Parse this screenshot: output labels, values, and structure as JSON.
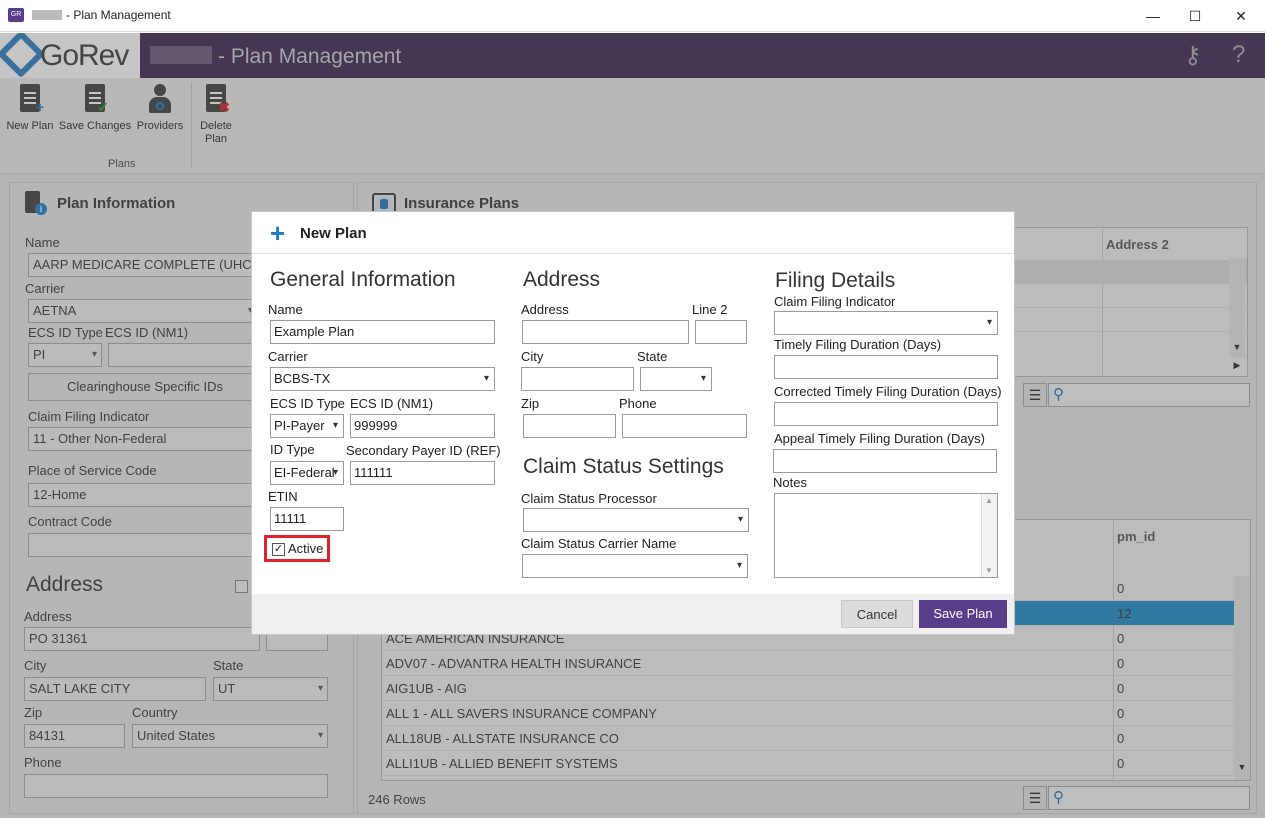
{
  "window": {
    "title": "- Plan Management",
    "minimize": "—",
    "maximize": "☐",
    "close": "✕"
  },
  "header": {
    "logo": "GoRev",
    "title": "- Plan Management",
    "icons": [
      "keys-icon",
      "help-icon"
    ],
    "help": "?"
  },
  "ribbon": {
    "buttons": [
      {
        "label": "New Plan"
      },
      {
        "label": "Save Changes"
      },
      {
        "label": "Providers"
      },
      {
        "label": "Delete Plan"
      }
    ],
    "group_label": "Plans"
  },
  "plan_info": {
    "title": "Plan Information",
    "name_label": "Name",
    "name": "AARP MEDICARE COMPLETE (UHC)a",
    "carrier_label": "Carrier",
    "carrier": "AETNA",
    "ecs_type_label": "ECS ID Type",
    "ecs_type": "PI",
    "ecs_id_label": "ECS ID (NM1)",
    "ecs_id": "",
    "clearinghouse_button": "Clearinghouse Specific IDs",
    "claim_filing_label": "Claim Filing Indicator",
    "claim_filing": "11 - Other Non-Federal",
    "pos_label": "Place of Service Code",
    "pos": "12-Home",
    "contract_label": "Contract Code",
    "contract": "",
    "address_title": "Address",
    "address_label": "Address",
    "address": "PO 31361",
    "city_label": "City",
    "city": "SALT LAKE CITY",
    "state_label": "State",
    "state": "UT",
    "zip_label": "Zip",
    "zip": "84131",
    "country_label": "Country",
    "country": "United States",
    "phone_label": "Phone",
    "phone": ""
  },
  "insurance_plans": {
    "title": "Insurance Plans",
    "top_col": "Address 2",
    "bottom_col": "pm_id",
    "rows": [
      {
        "name": "",
        "pm_id": "0"
      },
      {
        "name": "",
        "pm_id": "12"
      },
      {
        "name": "ACE AMERICAN INSURANCE",
        "pm_id": "0"
      },
      {
        "name": "ADV07 - ADVANTRA HEALTH INSURANCE",
        "pm_id": "0"
      },
      {
        "name": "AIG1UB - AIG",
        "pm_id": "0"
      },
      {
        "name": "ALL 1 - ALL SAVERS INSURANCE COMPANY",
        "pm_id": "0"
      },
      {
        "name": "ALL18UB - ALLSTATE INSURANCE CO",
        "pm_id": "0"
      },
      {
        "name": "ALLI1UB - ALLIED BENEFIT SYSTEMS",
        "pm_id": "0"
      }
    ],
    "row_count": "246 Rows"
  },
  "dialog": {
    "title": "New Plan",
    "general": {
      "title": "General Information",
      "name_label": "Name",
      "name": "Example Plan",
      "carrier_label": "Carrier",
      "carrier": "BCBS-TX",
      "ecs_type_label": "ECS ID Type",
      "ecs_type": "PI-Payer",
      "ecs_id_label": "ECS ID (NM1)",
      "ecs_id": "999999",
      "id_type_label": "ID Type",
      "id_type": "EI-Federal",
      "secondary_label": "Secondary Payer ID (REF)",
      "secondary": "111111",
      "etin_label": "ETIN",
      "etin": "11111",
      "active_label": "Active",
      "active_check": "✓"
    },
    "address": {
      "title": "Address",
      "address_label": "Address",
      "line2_label": "Line 2",
      "city_label": "City",
      "state_label": "State",
      "zip_label": "Zip",
      "phone_label": "Phone"
    },
    "claim_status": {
      "title": "Claim Status Settings",
      "processor_label": "Claim Status Processor",
      "carrier_name_label": "Claim Status Carrier Name"
    },
    "filing": {
      "title": "Filing Details",
      "indicator_label": "Claim Filing Indicator",
      "timely_label": "Timely Filing Duration (Days)",
      "corrected_label": "Corrected Timely Filing Duration (Days)",
      "appeal_label": "Appeal Timely Filing Duration (Days)",
      "notes_label": "Notes"
    },
    "cancel": "Cancel",
    "save": "Save Plan"
  },
  "colors": {
    "header": "#3a2452",
    "accent": "#5a3d8a",
    "selected_row": "#1b8cc8",
    "highlight": "#e2222a"
  }
}
